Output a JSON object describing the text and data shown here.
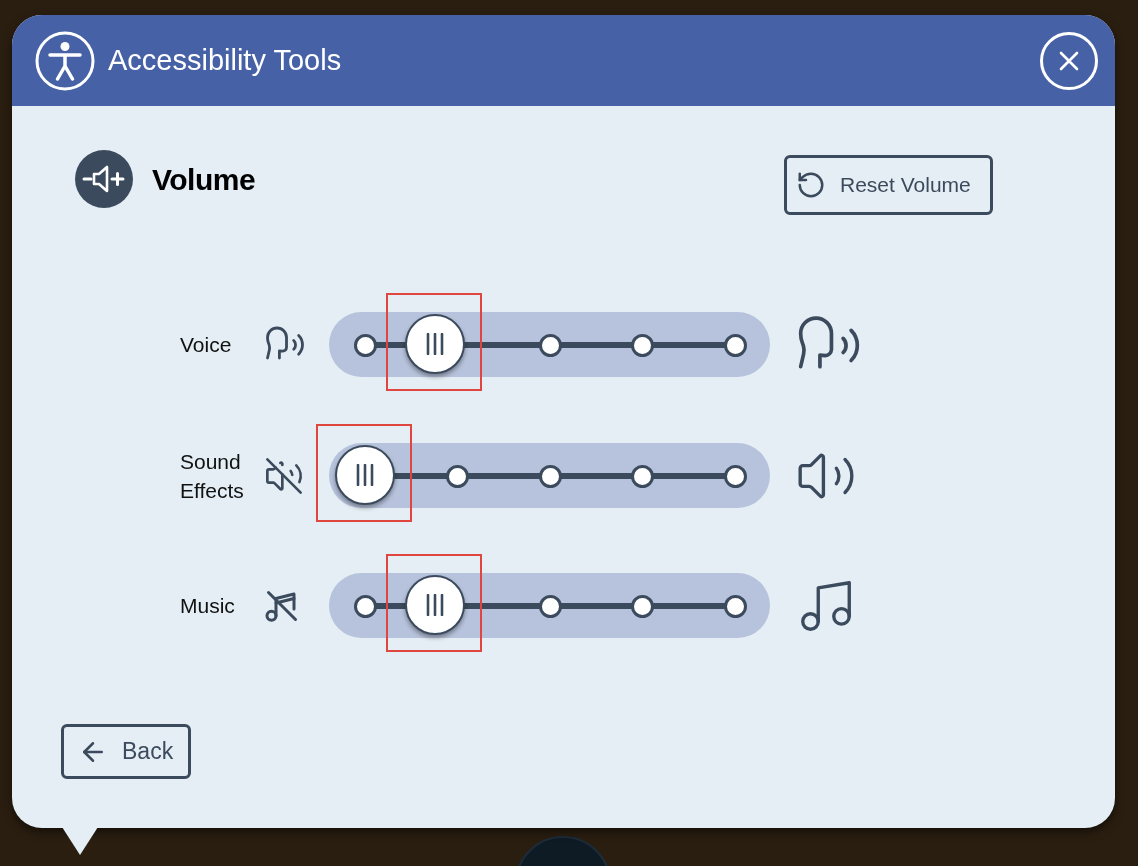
{
  "dialog": {
    "title": "Accessibility Tools"
  },
  "section": {
    "title": "Volume",
    "reset_button": "Reset Volume"
  },
  "channels": [
    {
      "kind": "voice",
      "name": "Voice",
      "level": 0.19,
      "highlighted": true
    },
    {
      "kind": "effects",
      "name": "Sound Effects",
      "level": 0,
      "highlighted": true
    },
    {
      "kind": "music",
      "name": "Music",
      "level": 0.19,
      "highlighted": true
    }
  ],
  "back_button": "Back"
}
